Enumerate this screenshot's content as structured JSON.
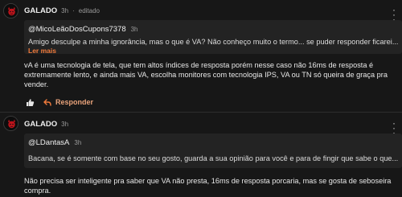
{
  "colors": {
    "background": "#171717",
    "quote_background": "#232323",
    "accent": "#f07a3b",
    "text": "#e4e4e4",
    "muted": "#9a9a9a"
  },
  "comments": [
    {
      "author": "GALADO",
      "time": "3h",
      "edited_sep": "·",
      "edited": "editado",
      "avatar_icon": "devil-avatar-icon",
      "quote": {
        "author": "@MicoLeãoDosCupons7378",
        "time": "3h",
        "text": "Amigo desculpe a minha ignorância, mas o que é VA? Não conheço muito o termo... se puder responder ficarei...",
        "read_more": "Ler mais"
      },
      "body": "vA é uma tecnologia de tela, que tem altos índices de resposta porém nesse caso não 16ms de resposta é extremamente lento, e ainda mais VA, escolha monitores com tecnologia IPS, VA ou TN só queira de graça pra vender.",
      "reply_label": "Responder",
      "like_icon": "thumbs-up-icon",
      "reply_icon": "reply-arrow-icon"
    },
    {
      "author": "GALADO",
      "time": "3h",
      "avatar_icon": "devil-avatar-icon",
      "quote": {
        "author": "@LDantasA",
        "time": "3h",
        "text": "Bacana, se é somente com base no seu gosto, guarda a sua opinião para você e para de fingir que sabe o que..."
      },
      "body": "Não precisa ser inteligente pra saber que VA não presta, 16ms de resposta porcaria, mas se gosta de seboseira compra."
    }
  ]
}
